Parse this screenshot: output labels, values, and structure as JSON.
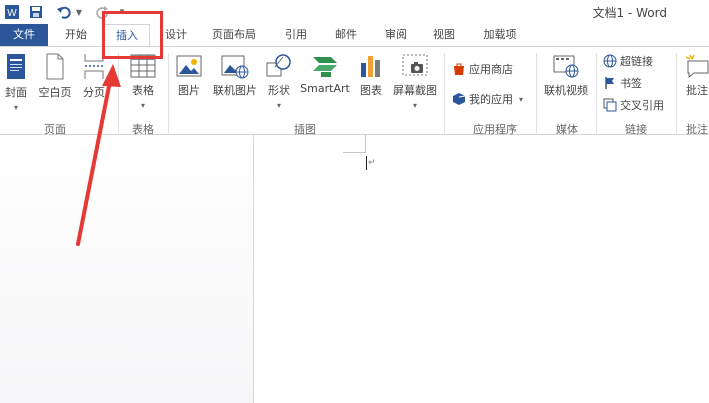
{
  "window": {
    "title": "文档1 - Word"
  },
  "qat": {
    "more_label": "▾"
  },
  "tabs": [
    {
      "id": "file",
      "label": "文件"
    },
    {
      "id": "home",
      "label": "开始"
    },
    {
      "id": "insert",
      "label": "插入"
    },
    {
      "id": "design",
      "label": "设计"
    },
    {
      "id": "layout",
      "label": "页面布局"
    },
    {
      "id": "references",
      "label": "引用"
    },
    {
      "id": "mailings",
      "label": "邮件"
    },
    {
      "id": "review",
      "label": "审阅"
    },
    {
      "id": "view",
      "label": "视图"
    },
    {
      "id": "addins",
      "label": "加载项"
    }
  ],
  "active_tab": "插入",
  "ribbon": {
    "pages": {
      "cover": "封面",
      "blank": "空白页",
      "break": "分页",
      "group": "页面"
    },
    "tables": {
      "table": "表格",
      "group": "表格"
    },
    "illustrations": {
      "picture": "图片",
      "online_picture": "联机图片",
      "shapes": "形状",
      "smartart": "SmartArt",
      "chart": "图表",
      "screenshot": "屏幕截图",
      "group": "插图"
    },
    "apps": {
      "store": "应用商店",
      "my_apps": "我的应用",
      "group": "应用程序"
    },
    "media": {
      "online_video": "联机视频",
      "group": "媒体"
    },
    "links": {
      "hyperlink": "超链接",
      "bookmark": "书签",
      "cross_ref": "交叉引用",
      "group": "链接"
    },
    "comments": {
      "comment": "批注",
      "group": "批注"
    }
  },
  "colors": {
    "accent": "#2b579a",
    "highlight": "#e53935"
  }
}
